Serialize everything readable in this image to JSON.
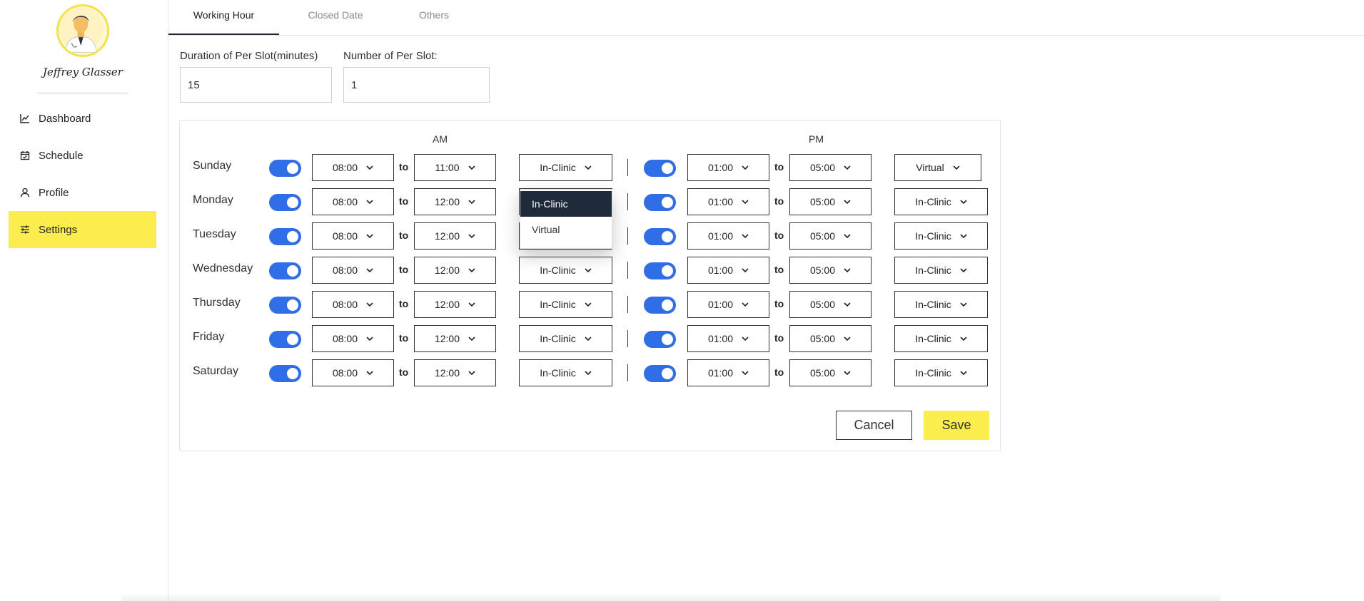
{
  "profile": {
    "name": "Jeffrey Glasser"
  },
  "sidebar": {
    "items": [
      {
        "label": "Dashboard",
        "icon": "chart-line-icon"
      },
      {
        "label": "Schedule",
        "icon": "calendar-check-icon"
      },
      {
        "label": "Profile",
        "icon": "user-icon"
      },
      {
        "label": "Settings",
        "icon": "sliders-icon",
        "active": true
      }
    ]
  },
  "tabs": [
    {
      "label": "Working Hour",
      "active": true
    },
    {
      "label": "Closed Date"
    },
    {
      "label": "Others"
    }
  ],
  "slot": {
    "duration_label": "Duration of Per Slot(minutes)",
    "duration_value": "15",
    "number_label": "Number of Per Slot:",
    "number_value": "1"
  },
  "columns": {
    "am": "AM",
    "pm": "PM",
    "to": "to"
  },
  "schedule": [
    {
      "day": "Sunday",
      "am_on": true,
      "am_start": "08:00",
      "am_end": "11:00",
      "am_type": "In-Clinic",
      "pm_on": true,
      "pm_start": "01:00",
      "pm_end": "05:00",
      "pm_type": "Virtual"
    },
    {
      "day": "Monday",
      "am_on": true,
      "am_start": "08:00",
      "am_end": "12:00",
      "am_type": "In-Clinic",
      "pm_on": true,
      "pm_start": "01:00",
      "pm_end": "05:00",
      "pm_type": "In-Clinic"
    },
    {
      "day": "Tuesday",
      "am_on": true,
      "am_start": "08:00",
      "am_end": "12:00",
      "am_type": "In-Clinic",
      "pm_on": true,
      "pm_start": "01:00",
      "pm_end": "05:00",
      "pm_type": "In-Clinic"
    },
    {
      "day": "Wednesday",
      "am_on": true,
      "am_start": "08:00",
      "am_end": "12:00",
      "am_type": "In-Clinic",
      "pm_on": true,
      "pm_start": "01:00",
      "pm_end": "05:00",
      "pm_type": "In-Clinic"
    },
    {
      "day": "Thursday",
      "am_on": true,
      "am_start": "08:00",
      "am_end": "12:00",
      "am_type": "In-Clinic",
      "pm_on": true,
      "pm_start": "01:00",
      "pm_end": "05:00",
      "pm_type": "In-Clinic"
    },
    {
      "day": "Friday",
      "am_on": true,
      "am_start": "08:00",
      "am_end": "12:00",
      "am_type": "In-Clinic",
      "pm_on": true,
      "pm_start": "01:00",
      "pm_end": "05:00",
      "pm_type": "In-Clinic"
    },
    {
      "day": "Saturday",
      "am_on": true,
      "am_start": "08:00",
      "am_end": "12:00",
      "am_type": "In-Clinic",
      "pm_on": true,
      "pm_start": "01:00",
      "pm_end": "05:00",
      "pm_type": "In-Clinic"
    }
  ],
  "dropdown": {
    "options": [
      {
        "label": "In-Clinic",
        "selected": true
      },
      {
        "label": "Virtual"
      }
    ]
  },
  "actions": {
    "cancel": "Cancel",
    "save": "Save"
  },
  "colors": {
    "accent": "#fbed4d",
    "toggle": "#2f6ee6",
    "dropdown_active": "#1f2a3b"
  }
}
